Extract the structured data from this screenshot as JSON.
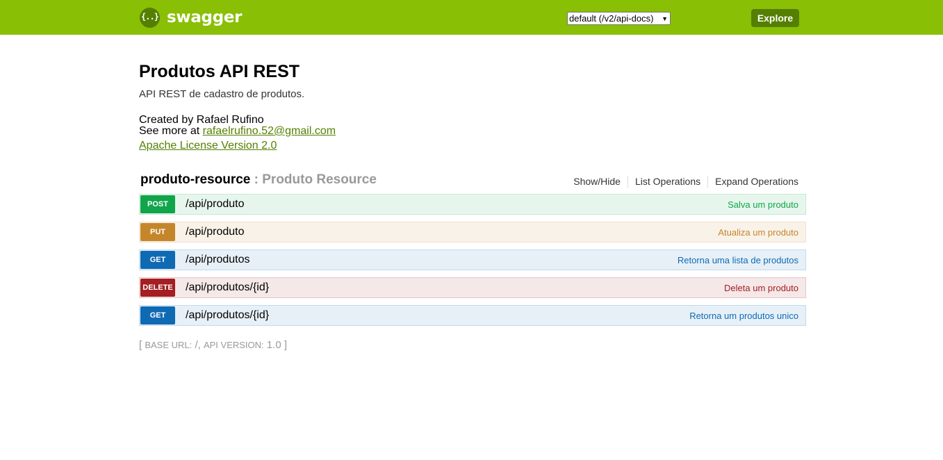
{
  "header": {
    "logo_glyph": "{..}",
    "logo_text": "swagger",
    "spec_selected": "default (/v2/api-docs)",
    "explore_label": "Explore"
  },
  "info": {
    "title": "Produtos API REST",
    "description": "API REST de cadastro de produtos.",
    "created_by": "Created by Rafael Rufino",
    "see_more_prefix": "See more at",
    "email": "rafaelrufino.52@gmail.com",
    "license": "Apache License Version 2.0"
  },
  "resource": {
    "name": "produto-resource",
    "separator": ":",
    "description": "Produto Resource",
    "actions": [
      "Show/Hide",
      "List Operations",
      "Expand Operations"
    ]
  },
  "operations": [
    {
      "method": "POST",
      "path": "/api/produto",
      "summary": "Salva um produto"
    },
    {
      "method": "PUT",
      "path": "/api/produto",
      "summary": "Atualiza um produto"
    },
    {
      "method": "GET",
      "path": "/api/produtos",
      "summary": "Retorna uma lista de produtos"
    },
    {
      "method": "DELETE",
      "path": "/api/produtos/{id}",
      "summary": "Deleta um produto"
    },
    {
      "method": "GET",
      "path": "/api/produtos/{id}",
      "summary": "Retorna um produtos unico"
    }
  ],
  "footer": {
    "open_bracket": "[",
    "base_url_label": "BASE URL:",
    "base_url": "/",
    "comma": ",",
    "api_version_label": "API VERSION:",
    "api_version": "1.0",
    "close_bracket": "]"
  },
  "colors": {
    "header_bg": "#89bf04",
    "accent_dark": "#547f00",
    "post": "#10a54a",
    "put": "#c5862b",
    "get": "#0f6ab4",
    "delete": "#a41e22"
  }
}
